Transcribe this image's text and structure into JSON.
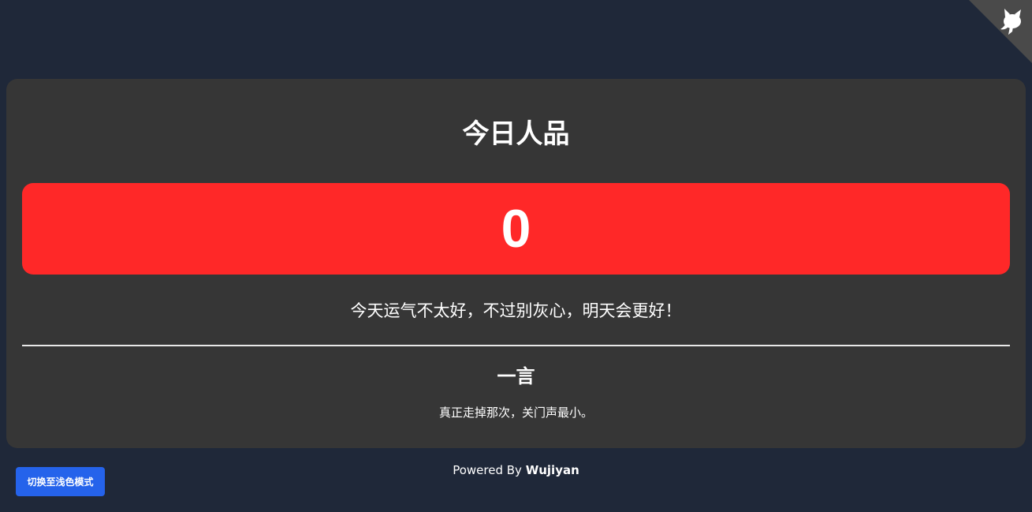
{
  "corner": {
    "icon": "github-octocat-icon",
    "color": "#4a4a4a"
  },
  "main": {
    "title": "今日人品",
    "score": "0",
    "score_color": "#ff2828",
    "message": "今天运气不太好，不过别灰心，明天会更好！"
  },
  "hitokoto": {
    "title": "一言",
    "text": "真正走掉那次，关门声最小。"
  },
  "footer": {
    "prefix": "Powered By ",
    "author": "Wujiyan"
  },
  "theme_toggle": {
    "label": "切换至浅色模式",
    "color": "#2563eb"
  },
  "colors": {
    "page_background": "#1f2839",
    "card_background": "#363636"
  }
}
